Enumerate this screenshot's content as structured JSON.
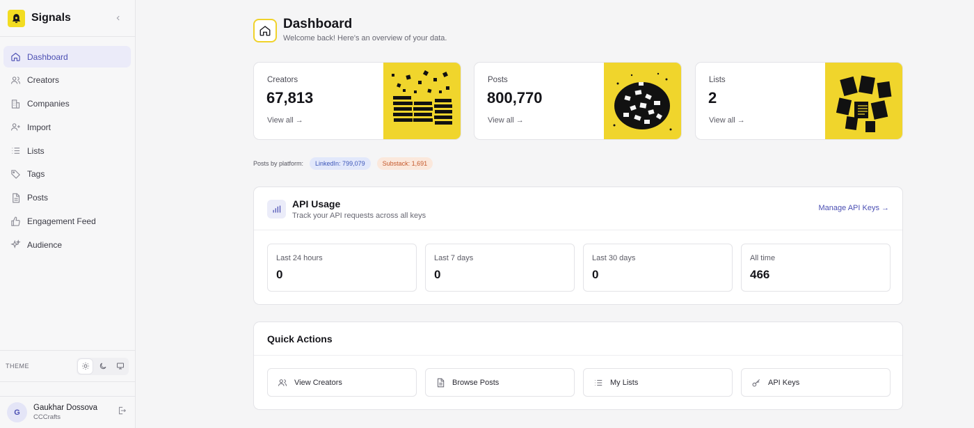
{
  "app": {
    "name": "Signals"
  },
  "sidebar": {
    "items": [
      {
        "label": "Dashboard",
        "icon": "home-icon",
        "active": true
      },
      {
        "label": "Creators",
        "icon": "users-icon"
      },
      {
        "label": "Companies",
        "icon": "building-icon"
      },
      {
        "label": "Import",
        "icon": "user-plus-icon"
      },
      {
        "label": "Lists",
        "icon": "list-icon"
      },
      {
        "label": "Tags",
        "icon": "tag-icon"
      },
      {
        "label": "Posts",
        "icon": "document-icon"
      },
      {
        "label": "Engagement Feed",
        "icon": "thumbs-up-icon"
      },
      {
        "label": "Audience",
        "icon": "sparkles-icon"
      }
    ],
    "theme_label": "THEME",
    "theme_options": [
      "light",
      "dark",
      "system"
    ],
    "theme_selected": "light"
  },
  "user": {
    "initial": "G",
    "name": "Gaukhar Dossova",
    "org": "CCCrafts"
  },
  "header": {
    "title": "Dashboard",
    "subtitle": "Welcome back! Here's an overview of your data."
  },
  "stats": [
    {
      "label": "Creators",
      "value": "67,813",
      "link": "View all →"
    },
    {
      "label": "Posts",
      "value": "800,770",
      "link": "View all →"
    },
    {
      "label": "Lists",
      "value": "2",
      "link": "View all →"
    }
  ],
  "platforms": {
    "label": "Posts by platform:",
    "linkedin": "LinkedIn: 799,079",
    "substack": "Substack: 1,691"
  },
  "api_usage": {
    "title": "API Usage",
    "subtitle": "Track your API requests across all keys",
    "link": "Manage API Keys →",
    "periods": [
      {
        "label": "Last 24 hours",
        "value": "0"
      },
      {
        "label": "Last 7 days",
        "value": "0"
      },
      {
        "label": "Last 30 days",
        "value": "0"
      },
      {
        "label": "All time",
        "value": "466"
      }
    ]
  },
  "quick_actions": {
    "title": "Quick Actions",
    "buttons": [
      {
        "label": "View Creators",
        "icon": "users-icon"
      },
      {
        "label": "Browse Posts",
        "icon": "document-icon"
      },
      {
        "label": "My Lists",
        "icon": "list-icon"
      },
      {
        "label": "API Keys",
        "icon": "key-icon"
      }
    ]
  },
  "colors": {
    "accent": "#4b4fb3",
    "brand_yellow": "#f0d52c",
    "linkedin_bg": "#e2e8fb",
    "substack_bg": "#fbe8dc"
  }
}
